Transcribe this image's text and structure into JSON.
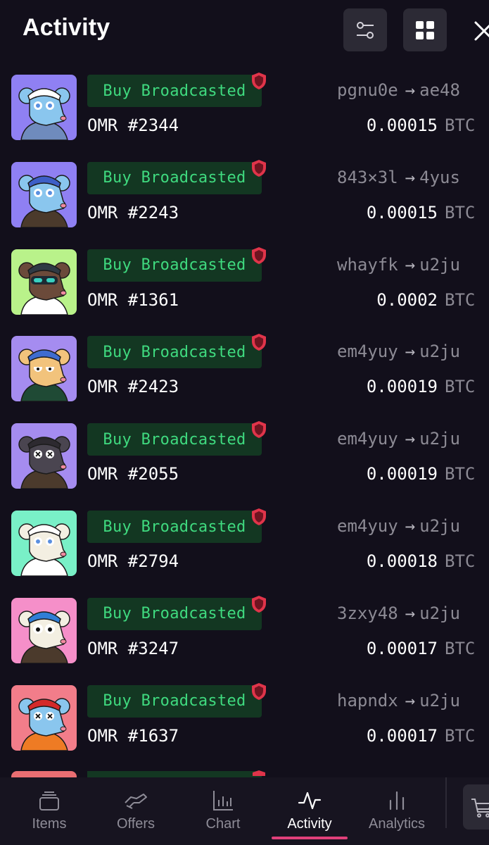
{
  "header": {
    "title": "Activity",
    "filter_icon": "sliders-icon",
    "grid_icon": "grid-icon",
    "close_icon": "close-icon"
  },
  "colors": {
    "background": "#120f1b",
    "badge_bg": "#133722",
    "badge_text": "#3fda7f",
    "muted_text": "#8c8a94",
    "shield": "#e0344a",
    "active_tab_underline": "#e0407a"
  },
  "activity": [
    {
      "status": "Buy Broadcasted",
      "name": "OMR #2344",
      "from": "pgnu0e",
      "to": "ae48",
      "price": "0.00015",
      "currency": "BTC",
      "thumb": {
        "bg": "#8f80f3",
        "skin": "#8ac6ee",
        "hat": "#ffffff",
        "shirt": "#6f8bbd",
        "eyes": "blue"
      }
    },
    {
      "status": "Buy Broadcasted",
      "name": "OMR #2243",
      "from": "843×3l",
      "to": "4yus",
      "price": "0.00015",
      "currency": "BTC",
      "thumb": {
        "bg": "#8f80f3",
        "skin": "#8ac6ee",
        "hat": "#3d5fc7",
        "shirt": "#4b3a2c",
        "eyes": "blue"
      }
    },
    {
      "status": "Buy Broadcasted",
      "name": "OMR #1361",
      "from": "whayfk",
      "to": "u2ju",
      "price": "0.0002",
      "currency": "BTC",
      "thumb": {
        "bg": "#b9f28a",
        "skin": "#6b4a3a",
        "hat": "#2f3a44",
        "shirt": "#ffffff",
        "eyes": "goggles"
      }
    },
    {
      "status": "Buy Broadcasted",
      "name": "OMR #2423",
      "from": "em4yuy",
      "to": "u2ju",
      "price": "0.00019",
      "currency": "BTC",
      "thumb": {
        "bg": "#a58cf0",
        "skin": "#f2c37c",
        "hat": "#3f6ccf",
        "shirt": "#1f4a35",
        "eyes": "sleepy"
      }
    },
    {
      "status": "Buy Broadcasted",
      "name": "OMR #2055",
      "from": "em4yuy",
      "to": "u2ju",
      "price": "0.00019",
      "currency": "BTC",
      "thumb": {
        "bg": "#a58cf0",
        "skin": "#4a4550",
        "hat": "#2d2a30",
        "shirt": "#4b3a2c",
        "eyes": "x"
      }
    },
    {
      "status": "Buy Broadcasted",
      "name": "OMR #2794",
      "from": "em4yuy",
      "to": "u2ju",
      "price": "0.00018",
      "currency": "BTC",
      "thumb": {
        "bg": "#79f0c7",
        "skin": "#f3efe2",
        "hat": "#ffffff",
        "shirt": "#ffffff",
        "eyes": "blue"
      }
    },
    {
      "status": "Buy Broadcasted",
      "name": "OMR #3247",
      "from": "3zxy48",
      "to": "u2ju",
      "price": "0.00017",
      "currency": "BTC",
      "thumb": {
        "bg": "#f58fc9",
        "skin": "#f3efe2",
        "hat": "#2f7ed6",
        "shirt": "#4b3a2c",
        "eyes": "wide"
      }
    },
    {
      "status": "Buy Broadcasted",
      "name": "OMR #1637",
      "from": "hapndx",
      "to": "u2ju",
      "price": "0.00017",
      "currency": "BTC",
      "thumb": {
        "bg": "#f27d8a",
        "skin": "#8ac6ee",
        "hat": "#d42a2a",
        "shirt": "#ee7b24",
        "eyes": "x"
      }
    }
  ],
  "nav": {
    "tabs": [
      {
        "label": "Items",
        "icon": "stack-icon",
        "active": false
      },
      {
        "label": "Offers",
        "icon": "handshake-icon",
        "active": false
      },
      {
        "label": "Chart",
        "icon": "bar-chart-icon",
        "active": false
      },
      {
        "label": "Activity",
        "icon": "activity-pulse-icon",
        "active": true
      },
      {
        "label": "Analytics",
        "icon": "analytics-icon",
        "active": false
      }
    ],
    "cart_icon": "cart-icon"
  }
}
